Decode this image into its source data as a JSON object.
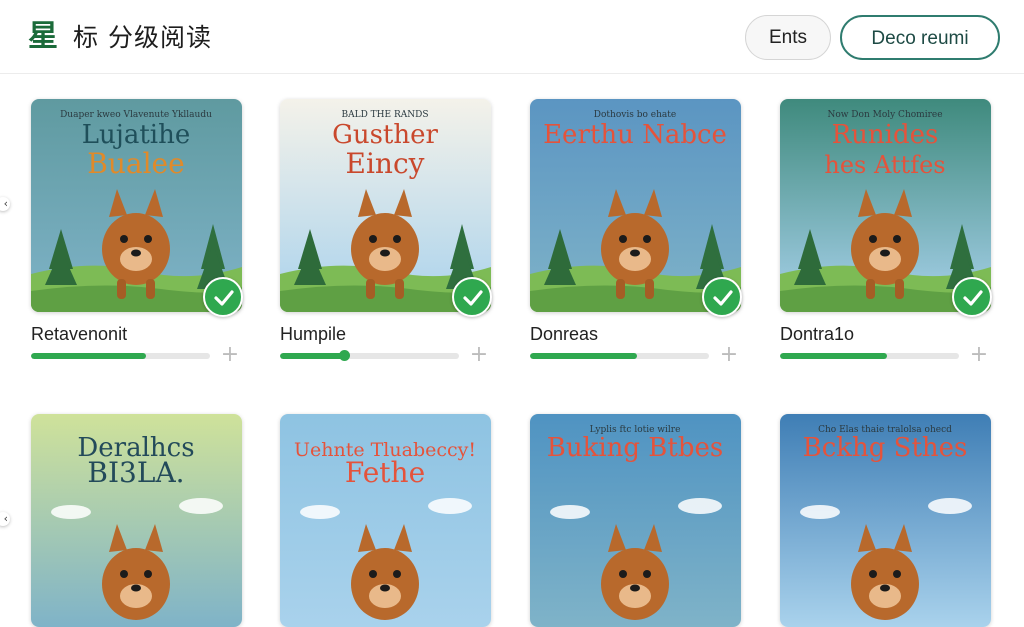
{
  "header": {
    "logo_char": "星",
    "title": "标 分级阅读",
    "buttons": {
      "ents_label": "Ents",
      "deco_label": "Deco reumi"
    }
  },
  "colors": {
    "accent_green": "#2fa84f",
    "brand_green": "#1b6b3a",
    "outline_teal": "#2f7c6f"
  },
  "books": [
    {
      "title": "Retavenonit",
      "cover_lines": [
        "Duaper kweo Vlavenute Ykllaudu",
        "Lujatihe",
        "Bualee"
      ],
      "progress": 0.64,
      "completed": true,
      "bg": "#5f9aa0"
    },
    {
      "title": "Humpile",
      "cover_lines": [
        "BALD THE RANDS",
        "Gusther",
        "Eincy"
      ],
      "progress": 0.36,
      "completed": true,
      "bg": "#f4f2ea"
    },
    {
      "title": "Donreas",
      "cover_lines": [
        "Dothovis bo ehate",
        "Eerthu Nabce",
        ""
      ],
      "progress": 0.6,
      "completed": true,
      "bg": "#5b95c2"
    },
    {
      "title": "Dontra1o",
      "cover_lines": [
        "Now Don Moly Chomiree",
        "Runides",
        "hes Attfes"
      ],
      "progress": 0.6,
      "completed": true,
      "bg": "#3f8a7d"
    },
    {
      "title": "",
      "cover_lines": [
        "",
        "Deralhcs",
        "BI3LA."
      ],
      "progress": null,
      "completed": false,
      "bg": "#cfe29a"
    },
    {
      "title": "",
      "cover_lines": [
        "",
        "Uehnte Tluabeccy!",
        "Fethe"
      ],
      "progress": null,
      "completed": false,
      "bg": "#8ec3e2"
    },
    {
      "title": "",
      "cover_lines": [
        "Lyplis ftc lotie wilre",
        "Buking Btbes",
        ""
      ],
      "progress": null,
      "completed": false,
      "bg": "#4f93c2"
    },
    {
      "title": "",
      "cover_lines": [
        "Cho Elas thaie tralolsa ohecd",
        "Bckhg Sthes",
        ""
      ],
      "progress": null,
      "completed": false,
      "bg": "#3f7eb5"
    }
  ]
}
